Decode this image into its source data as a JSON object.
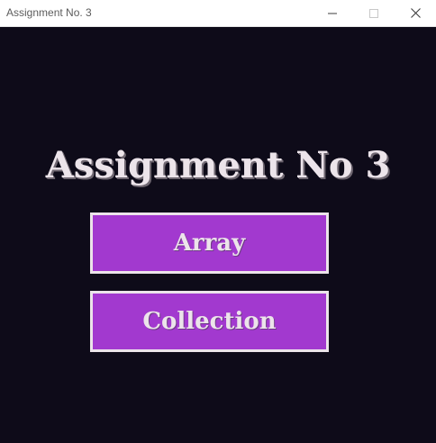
{
  "window": {
    "title": "Assignment No. 3",
    "controls": {
      "minimize_icon": "minimize-icon",
      "maximize_icon": "maximize-icon",
      "close_icon": "close-icon"
    }
  },
  "main": {
    "heading": "Assignment No 3",
    "buttons": [
      {
        "label": "Array"
      },
      {
        "label": "Collection"
      }
    ]
  },
  "colors": {
    "background": "#0e0b19",
    "button_fill": "#a239cf",
    "text": "#ece4ea"
  }
}
